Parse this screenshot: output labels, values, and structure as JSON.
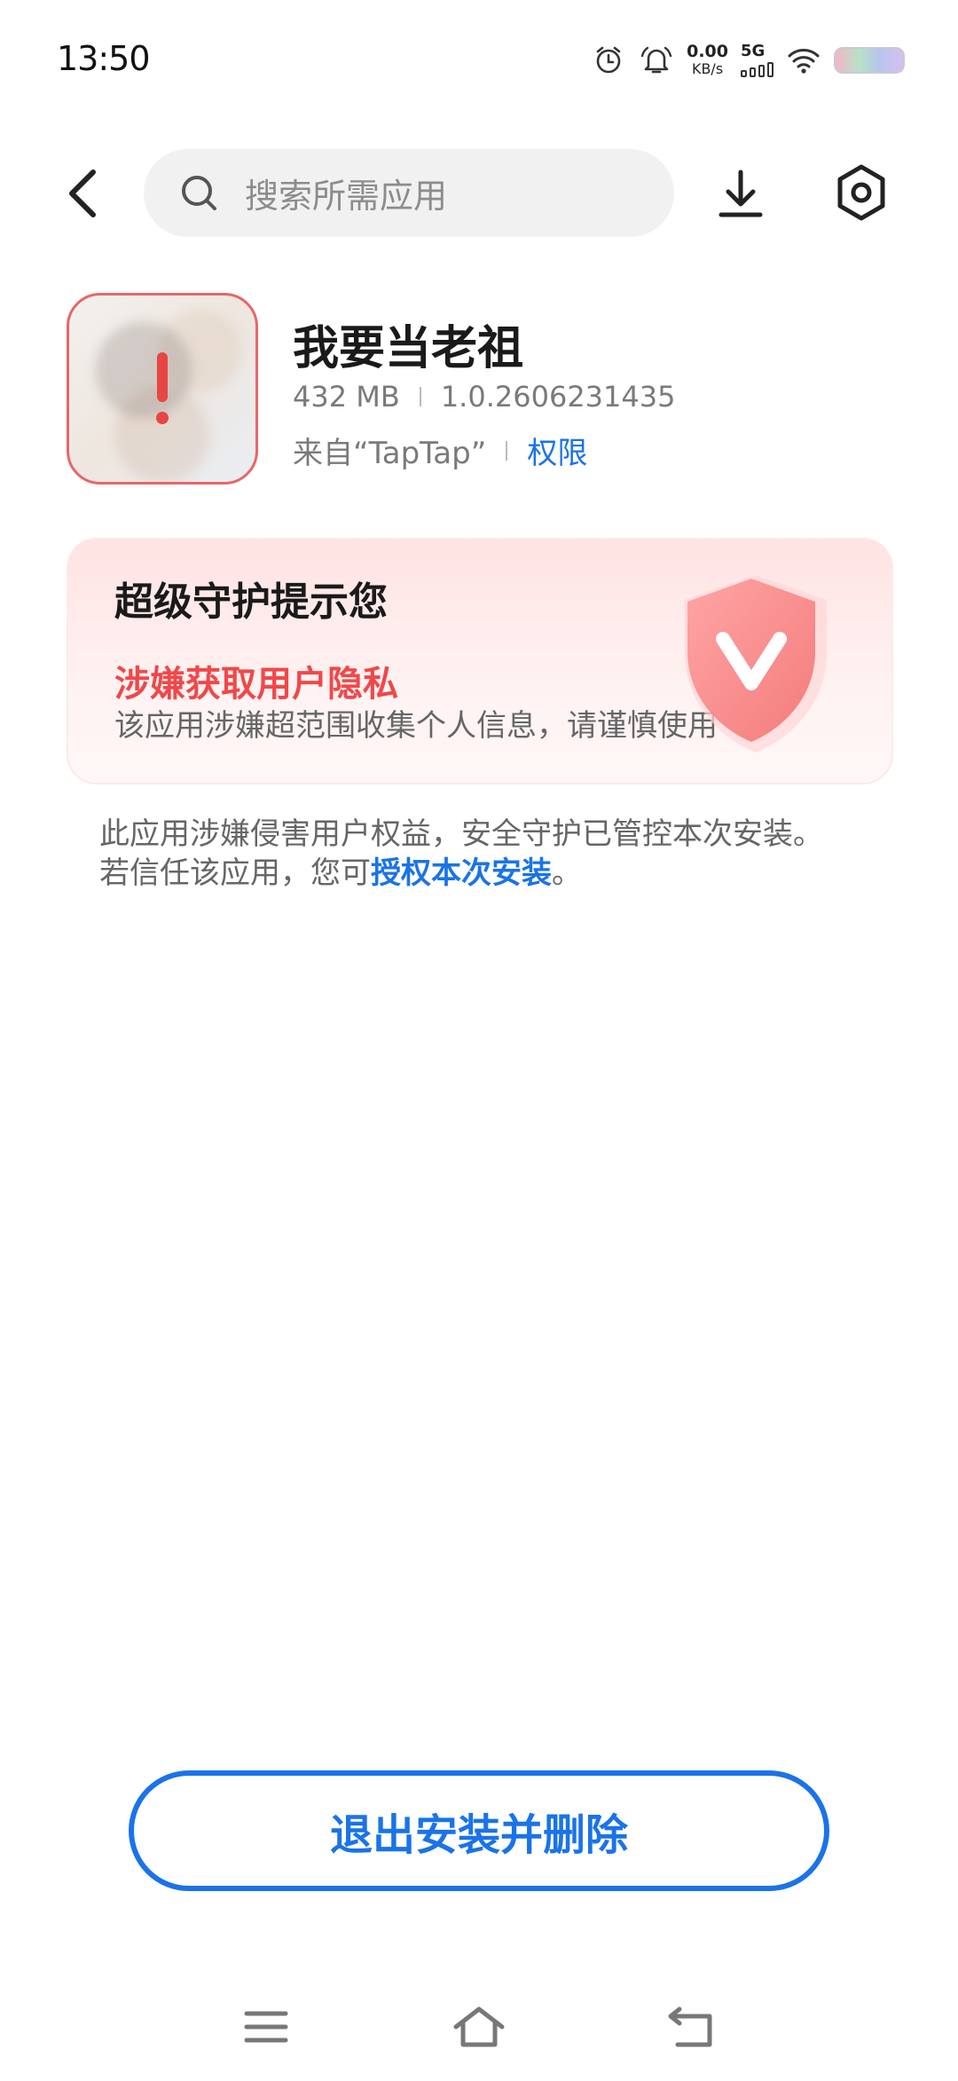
{
  "status_bar": {
    "time": "13:50",
    "net_speed_value": "0.00",
    "net_speed_unit": "KB/s",
    "network_type": "5G",
    "icons": [
      "alarm-icon",
      "notification-bell-icon",
      "wifi-icon",
      "battery-icon"
    ]
  },
  "toolbar": {
    "search_placeholder": "搜索所需应用",
    "icons": [
      "back-arrow-icon",
      "search-icon",
      "download-icon",
      "settings-icon"
    ]
  },
  "app": {
    "name": "我要当老祖",
    "size": "432 MB",
    "version": "1.0.2606231435",
    "source": "来自“TapTap”",
    "permissions_link": "权限"
  },
  "warning": {
    "title": "超级守护提示您",
    "risk": "涉嫌获取用户隐私",
    "description": "该应用涉嫌超范围收集个人信息，请谨慎使用"
  },
  "notice": {
    "text": "此应用涉嫌侵害用户权益，安全守护已管控本次安装。若信任该应用，您可",
    "link": "授权本次安装",
    "end": "。"
  },
  "actions": {
    "exit_button": "退出安装并删除"
  },
  "nav_bar": {
    "icons": [
      "menu-icon",
      "home-icon",
      "back-icon"
    ]
  },
  "colors": {
    "accent": "#1a73e8",
    "danger": "#f0484a",
    "card_bg": "#ffe8e8"
  }
}
